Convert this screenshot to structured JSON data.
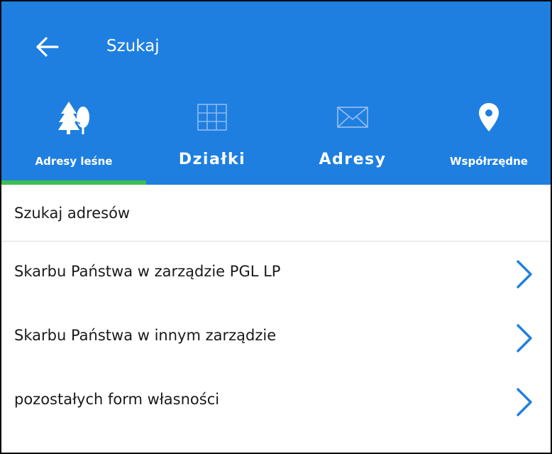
{
  "appbar": {
    "title": "Szukaj",
    "background": "#1E7FE0",
    "back_icon": "arrow-left-icon"
  },
  "tabs": [
    {
      "label": "Adresy leśne",
      "icon": "trees-icon",
      "active": true
    },
    {
      "label": "Działki",
      "icon": "grid-icon",
      "active": false
    },
    {
      "label": "Adresy",
      "icon": "envelope-icon",
      "active": false
    },
    {
      "label": "Współrzędne",
      "icon": "map-pin-icon",
      "active": false
    }
  ],
  "colors": {
    "accent": "#1E7FE0",
    "active_tab_indicator": "#3DBE4E",
    "chevron": "#1E7FE0"
  },
  "section": {
    "header": "Szukaj adresów"
  },
  "list": [
    {
      "label": "Skarbu Państwa w zarządzie PGL LP"
    },
    {
      "label": "Skarbu Państwa w innym zarządzie"
    },
    {
      "label": "pozostałych form własności"
    }
  ]
}
